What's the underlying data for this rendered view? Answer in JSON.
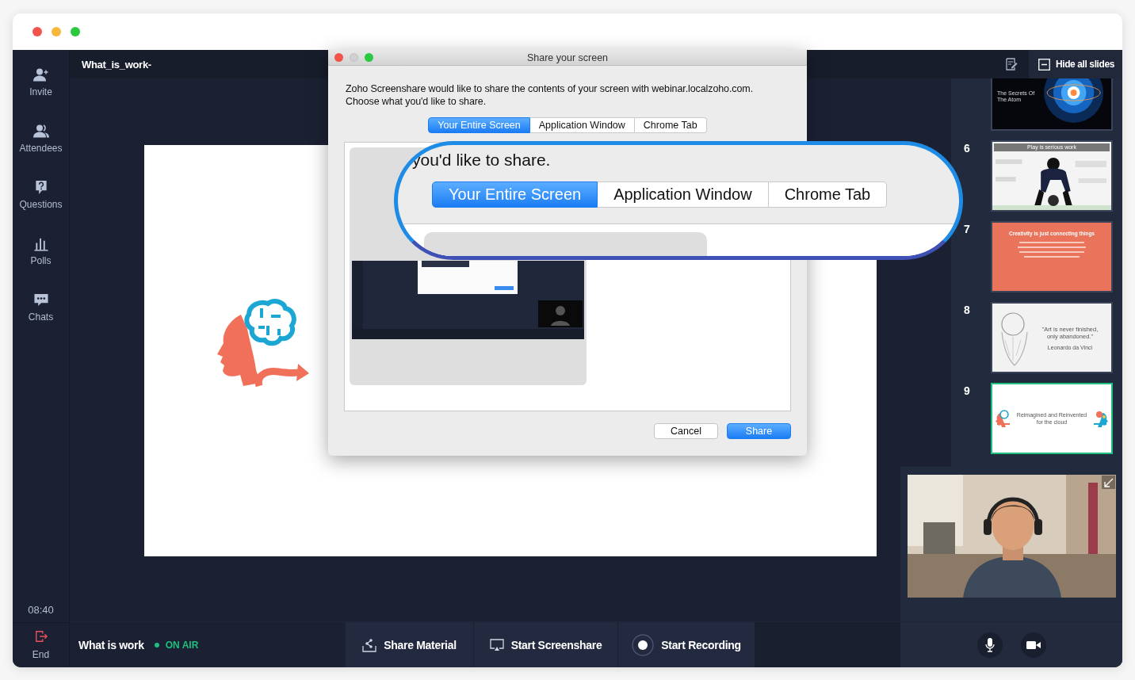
{
  "sidebar": {
    "items": [
      {
        "label": "Invite"
      },
      {
        "label": "Attendees"
      },
      {
        "label": "Questions"
      },
      {
        "label": "Polls"
      },
      {
        "label": "Chats"
      }
    ],
    "timer": "08:40",
    "end_label": "End"
  },
  "top_bar": {
    "title": "What_is_work-",
    "hide_slides": "Hide all slides"
  },
  "dialog": {
    "title": "Share your screen",
    "message": [
      "Zoho Screenshare would like to share the contents of your screen with webinar.localzoho.com.",
      "Choose what you'd like to share."
    ],
    "tabs": [
      {
        "label": "Your Entire Screen",
        "selected": true
      },
      {
        "label": "Application Window",
        "selected": false
      },
      {
        "label": "Chrome Tab",
        "selected": false
      }
    ],
    "buttons": [
      {
        "label": "Cancel",
        "primary": false
      },
      {
        "label": "Share",
        "primary": true
      }
    ]
  },
  "magnifier": {
    "text": "you'd like to share.",
    "tabs": [
      {
        "label": "Your Entire Screen",
        "selected": true
      },
      {
        "label": "Application Window",
        "selected": false
      },
      {
        "label": "Chrome Tab",
        "selected": false
      }
    ]
  },
  "slides": [
    {
      "kind": "atom",
      "title": "The Secrets Of The Atom",
      "selected": false
    },
    {
      "number": "6",
      "kind": "word-cloud",
      "title": "Play is serious work",
      "selected": false
    },
    {
      "number": "7",
      "kind": "quote-card",
      "title": "Creativity is just connecting things",
      "selected": false
    },
    {
      "number": "8",
      "kind": "portrait-quote",
      "title": "\"Art is never finished, only abandoned.\"",
      "caption": "Leonardo da Vinci",
      "selected": false
    },
    {
      "number": "9",
      "kind": "logo-pair",
      "title": "Reimagined and Reinvented for the cloud",
      "selected": true
    }
  ],
  "bottom_bar": {
    "session": "What is work",
    "status": "ON AIR",
    "actions": [
      {
        "label": "Share Material"
      },
      {
        "label": "Start Screenshare"
      },
      {
        "label": "Start Recording"
      }
    ]
  }
}
